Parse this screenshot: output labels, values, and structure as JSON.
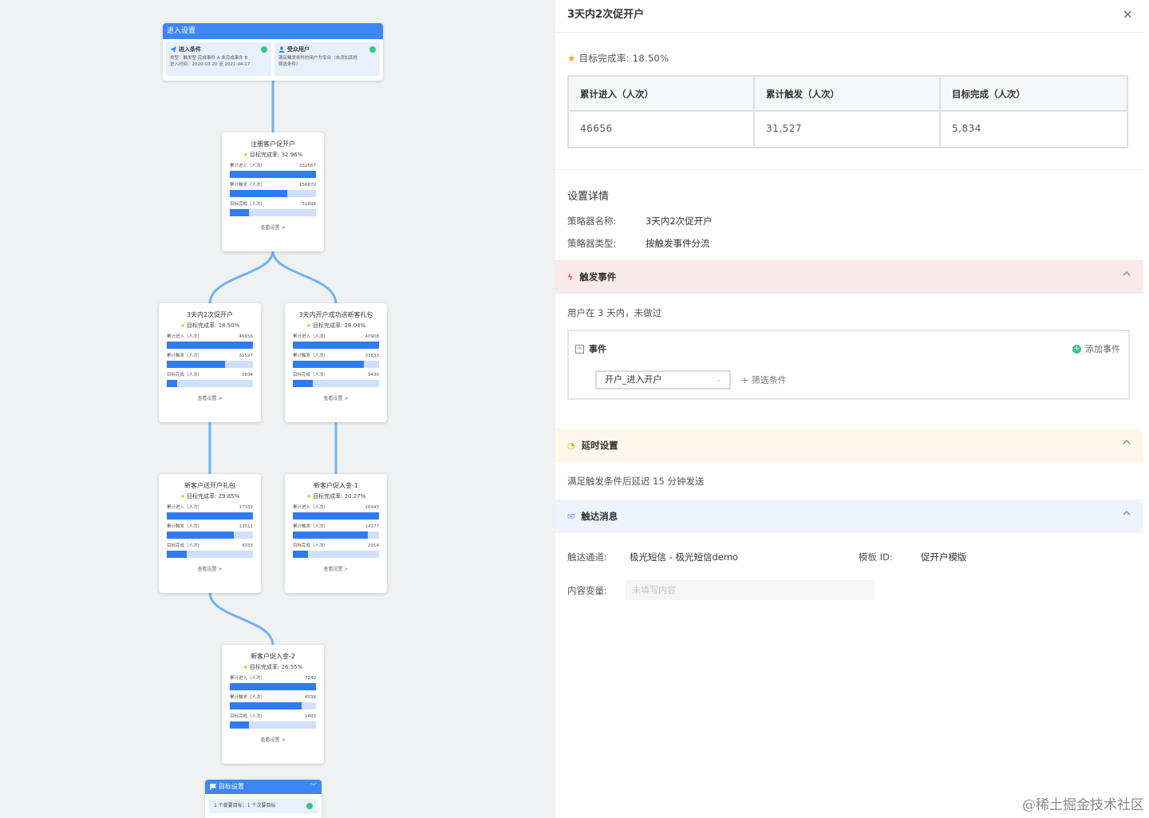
{
  "canvas": {
    "entry": {
      "header": "进入设置",
      "condition": {
        "title": "进入条件",
        "line1": "类型：触发型-完成事件 A 未完成事件 B",
        "line2": "进入时间：2020-03-20 至 2021-04-17"
      },
      "audience": {
        "title": "受众用户",
        "line1": "满足触发条件的用户为受众（未添加其他",
        "line2": "筛选条件）"
      }
    },
    "node_link_label": "查看设置 >",
    "metric_labels": [
      "累计进入（人次）",
      "累计触发（人次）",
      "目标完成（人次）"
    ],
    "nodes": [
      {
        "title": "注册客户促开户",
        "rate": "目标完成率: 32.96%",
        "values": [
          "232567",
          "156870",
          "51698"
        ],
        "fills": [
          1.0,
          0.67,
          0.22
        ]
      },
      {
        "title": "3天内2次促开户",
        "rate": "目标完成率: 18.50%",
        "values": [
          "46656",
          "31527",
          "5834"
        ],
        "fills": [
          1.0,
          0.68,
          0.12
        ]
      },
      {
        "title": "3天内开户成功送新客礼包",
        "rate": "目标完成率: 28.04%",
        "values": [
          "40908",
          "33633",
          "9430"
        ],
        "fills": [
          1.0,
          0.82,
          0.23
        ]
      },
      {
        "title": "新客户送开户礼包",
        "rate": "目标完成率: 29.85%",
        "values": [
          "17332",
          "13511",
          "4033"
        ],
        "fills": [
          1.0,
          0.78,
          0.23
        ]
      },
      {
        "title": "新客户促入金-1",
        "rate": "目标完成率: 20.27%",
        "values": [
          "16443",
          "14377",
          "2914"
        ],
        "fills": [
          1.0,
          0.87,
          0.18
        ]
      },
      {
        "title": "新客户促入金-2",
        "rate": "目标完成率: 26.55%",
        "values": [
          "7242",
          "6038",
          "1603"
        ],
        "fills": [
          1.0,
          0.83,
          0.22
        ]
      }
    ],
    "goal": {
      "header": "目标设置",
      "text": "1 个首要目标；1 个次要目标"
    }
  },
  "panel": {
    "title": "3天内2次促开户",
    "close_icon": "×",
    "rate_label": "目标完成率: 18.50%",
    "stats": {
      "headers": [
        "累计进入（人次）",
        "累计触发（人次）",
        "目标完成（人次）"
      ],
      "values": [
        "46656",
        "31,527",
        "5,834"
      ]
    },
    "settings": {
      "title": "设置详情",
      "name_label": "策略器名称:",
      "name_value": "3天内2次促开户",
      "type_label": "策略器类型:",
      "type_value": "按触发事件分流"
    },
    "trigger": {
      "title": "触发事件",
      "description": "用户在 3 天内，未做过",
      "event_label": "事件",
      "add_event": "添加事件",
      "selected_event": "开户_进入开户",
      "filter": "+ 筛选条件"
    },
    "delay": {
      "title": "延时设置",
      "description": "满足触发条件后延迟 15 分钟发送"
    },
    "message": {
      "title": "触达消息",
      "channel_label": "触达通道:",
      "channel_value": "极光短信 - 极光短信demo",
      "template_label": "模板 ID:",
      "template_value": "促开户模版",
      "content_label": "内容变量:",
      "content_placeholder": "未填写内容"
    },
    "watermark": "@稀土掘金技术社区"
  },
  "colors": {
    "accent": "#3d86f5",
    "bar_fill": "#2f7bf5",
    "bar_track": "#cfe0fb",
    "success": "#3cc38b",
    "star": "#f5a623",
    "trigger_bg": "#f9e9ea",
    "delay_bg": "#fdf7ea",
    "message_bg": "#eef4fc"
  },
  "icons": {
    "condition": "send-icon",
    "audience": "user-icon",
    "trigger": "lightning-icon",
    "delay": "clock-icon",
    "message": "envelope-icon",
    "goal": "flag-icon"
  }
}
